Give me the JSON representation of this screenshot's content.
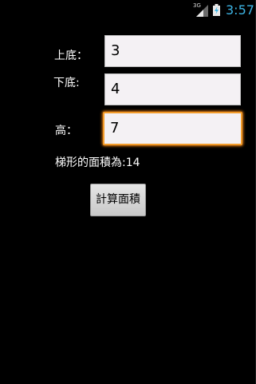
{
  "status_bar": {
    "network": "3G",
    "time": "3:57",
    "signal_icon": "signal-bars-icon",
    "battery_icon": "battery-charging-icon"
  },
  "form": {
    "top_base_label": "上底：",
    "top_base_value": "3",
    "bottom_base_label": "下底:",
    "bottom_base_value": "4",
    "height_label": "高：",
    "height_value": "7"
  },
  "result_text": "梯形的面積為:14",
  "calculate_button": "計算面積",
  "colors": {
    "background": "#000000",
    "time_text": "#3db4e4",
    "focus_border": "#f29b2a",
    "field_bg": "#f4f1f4"
  }
}
